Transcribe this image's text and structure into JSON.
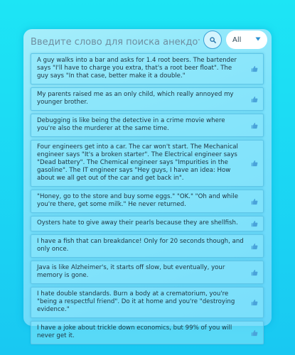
{
  "search": {
    "placeholder": "Введите слово для поиска анекдотов..."
  },
  "filter": {
    "selected": "All"
  },
  "icons": {
    "search": "search-icon",
    "dropdown": "chevron-down-icon",
    "like": "thumbs-up-icon"
  },
  "colors": {
    "background": "#1de5f5",
    "accent": "#3aa2d6"
  },
  "jokes": [
    {
      "text": "A guy walks into a bar and asks for 1.4 root beers. The bartender says \"I'll have to charge you extra, that's a root beer float\". The guy says \"In that case, better make it a double.\""
    },
    {
      "text": "My parents raised me as an only child, which really annoyed my younger brother."
    },
    {
      "text": "Debugging is like being the detective in a crime movie where you're also the murderer at the same time."
    },
    {
      "text": "Four engineers get into a car. The car won't start. The Mechanical engineer says \"It's a broken starter\". The Electrical engineer says \"Dead battery\". The Chemical engineer says \"Impurities in the gasoline\". The IT engineer says \"Hey guys, I have an idea: How about we all get out of the car and get back in\"."
    },
    {
      "text": "\"Honey, go to the store and buy some eggs.\" \"OK.\" \"Oh and while you're there, get some milk.\" He never returned."
    },
    {
      "text": "Oysters hate to give away their pearls because they are shellfish."
    },
    {
      "text": "I have a fish that can breakdance! Only for 20 seconds though, and only once."
    },
    {
      "text": "Java is like Alzheimer's, it starts off slow, but eventually, your memory is gone."
    },
    {
      "text": "I hate double standards. Burn a body at a crematorium, you're \"being a respectful friend\". Do it at home and you're \"destroying evidence.\""
    },
    {
      "text": "I have a joke about trickle down economics, but 99% of you will never get it."
    }
  ]
}
